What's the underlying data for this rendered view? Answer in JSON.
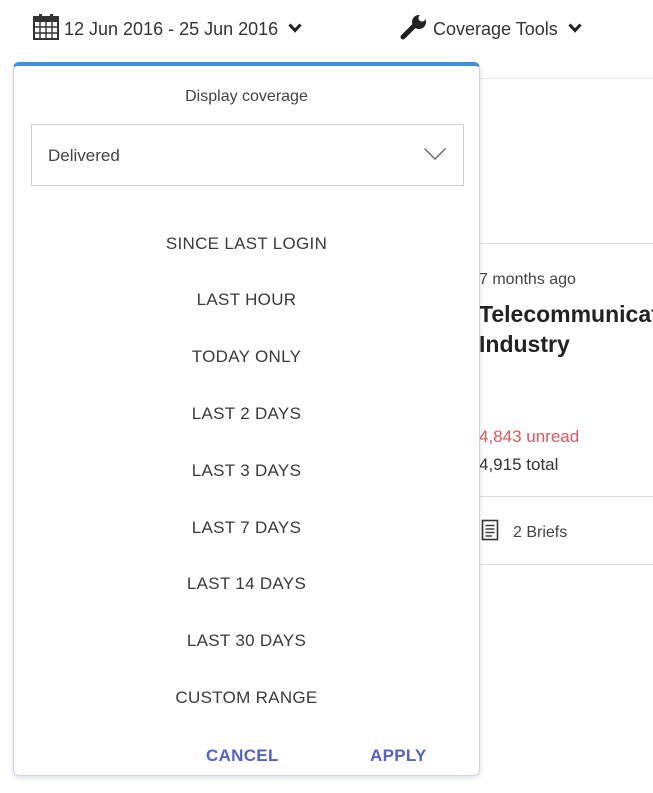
{
  "toolbar": {
    "date_range": "12 Jun 2016 - 25 Jun 2016",
    "coverage_tools": "Coverage Tools"
  },
  "panel": {
    "label": "Display coverage",
    "select_value": "Delivered",
    "options": [
      "SINCE LAST LOGIN",
      "LAST HOUR",
      "TODAY ONLY",
      "LAST 2 DAYS",
      "LAST 3 DAYS",
      "LAST 7 DAYS",
      "LAST 14 DAYS",
      "LAST 30 DAYS",
      "CUSTOM RANGE"
    ],
    "cancel_label": "CANCEL",
    "apply_label": "APPLY"
  },
  "card": {
    "time": "7 months ago",
    "title": "Telecommunications\nIndustry",
    "unread": "4,843 unread",
    "total": "4,915 total",
    "briefs": "2 Briefs"
  },
  "colors": {
    "accent_blue": "#3d8fe0",
    "button_text": "#5461c8",
    "unread_red": "#e0575e"
  },
  "icons": [
    "calendar-icon",
    "chevron-down-icon",
    "wrench-icon",
    "document-icon"
  ]
}
